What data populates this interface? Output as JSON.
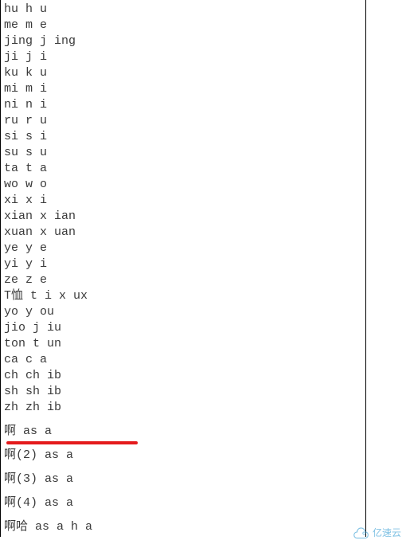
{
  "lines_top": [
    "hu h u",
    "me m e",
    "jing j ing",
    "ji j i",
    "ku k u",
    "mi m i",
    "ni n i",
    "ru r u",
    "si s i",
    "su s u",
    "ta t a",
    "wo w o",
    "xi x i",
    "xian x ian",
    "xuan x uan",
    "ye y e",
    "yi y i",
    "ze z e",
    "T恤 t i x ux",
    "yo y ou",
    "jio j iu",
    "ton t un",
    "ca c a",
    "ch ch ib",
    "sh sh ib",
    "zh zh ib"
  ],
  "lines_bottom": [
    "啊 as a",
    "啊(2) as a",
    "啊(3) as a",
    "啊(4) as a",
    "啊哈 as a h a"
  ],
  "watermark": {
    "text": "亿速云"
  },
  "annotation": {
    "red_underline_after": "zh zh ib"
  }
}
